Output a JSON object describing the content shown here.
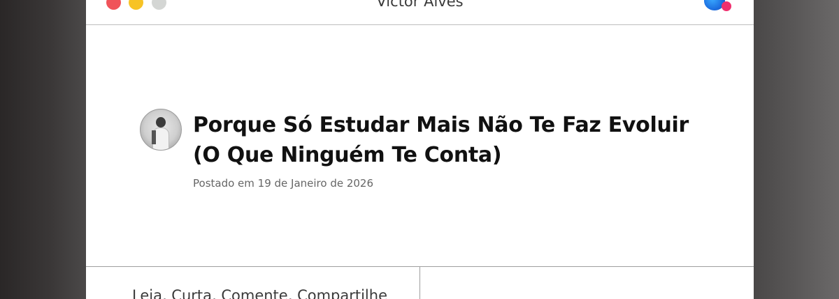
{
  "window": {
    "title": "Victor Alves"
  },
  "post": {
    "title": "Porque Só Estudar Mais Não Te Faz Evoluir (O Que Ninguém Te Conta)",
    "date": "Postado em 19 de Janeiro de 2026"
  },
  "footer": {
    "left_text": "Leia, Curta, Comente, Compartilhe"
  },
  "colors": {
    "close": "#f0545a",
    "minimize": "#f7c325",
    "maximize": "#d4d6d4",
    "logo_blue": "#1d6fe0",
    "logo_pink": "#ef2f6e"
  }
}
